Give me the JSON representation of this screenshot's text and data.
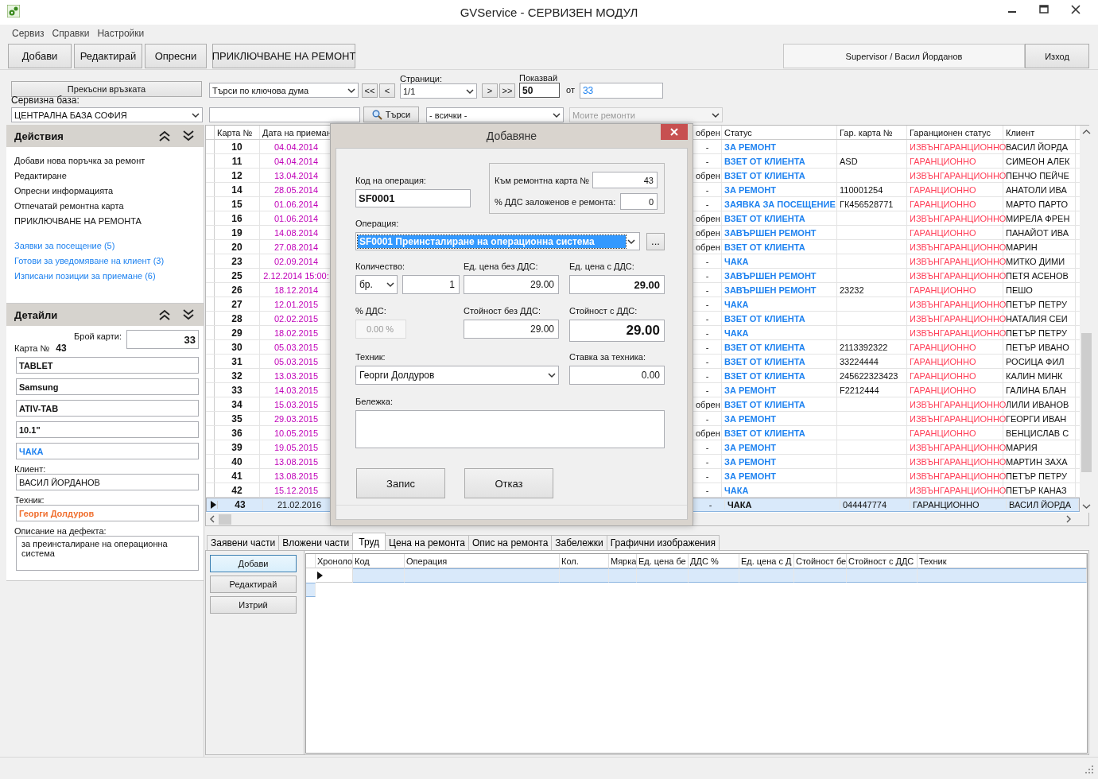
{
  "window": {
    "title": "GVService - СЕРВИЗЕН МОДУЛ"
  },
  "menu": [
    "Сервиз",
    "Справки",
    "Настройки"
  ],
  "toolbar": {
    "buttons": [
      "Добави",
      "Редактирай",
      "Опресни",
      "ПРИКЛЮЧВАНЕ НА РЕМОНТ"
    ],
    "user": "Supervisor / Васил Йорданов",
    "exit": "Изход"
  },
  "connection": {
    "disconnect_button": "Прекъсни връзката",
    "base_label": "Сервизна база:",
    "base_value": "ЦЕНТРАЛНА БАЗА СОФИЯ"
  },
  "search": {
    "mode": "Търси по ключова дума",
    "search_button": "Търси",
    "filter": "- всички -",
    "repairs_filter": "Моите ремонти",
    "repairs_filter_disabled": true
  },
  "paging": {
    "pages_label": "Страници:",
    "page": "1/1",
    "first": "<<",
    "prev": "<",
    "next": ">",
    "last": ">>",
    "show_label": "Показвай",
    "show_value": "50",
    "of_label": "от",
    "total": "33"
  },
  "actions": {
    "title": "Действия",
    "items": [
      "Добави нова поръчка за ремонт",
      "Редактиране",
      "Опресни информацията",
      "Отпечатай ремонтна карта",
      "ПРИКЛЮЧВАНЕ НА РЕМОНТА"
    ],
    "links": [
      "Заявки за посещение (5)",
      "Готови за уведомяване на клиент (3)",
      "Изписани позиции за приемане (6)"
    ]
  },
  "details": {
    "title": "Детайли",
    "count_label": "Брой карти:",
    "count": "33",
    "card_label": "Карта №",
    "card_number": "43",
    "fields": [
      {
        "value": "TABLET",
        "kind": "plain"
      },
      {
        "value": "Samsung",
        "kind": "plain"
      },
      {
        "value": "ATIV-TAB",
        "kind": "plain"
      },
      {
        "value": "10.1\"",
        "kind": "plain"
      },
      {
        "value": "ЧАКА",
        "kind": "status"
      }
    ],
    "client_label": "Клиент:",
    "client": "ВАСИЛ ЙОРДАНОВ",
    "technician_label": "Техник:",
    "technician": "Георги Долдуров",
    "defect_label": "Описание на дефекта:",
    "defect": "за преинсталиране на операционна система"
  },
  "grid": {
    "columns": [
      "Карта №",
      "Дата на приеман",
      "обрен",
      "Статус",
      "Гар. карта №",
      "Гаранционен статус",
      "Клиент"
    ],
    "rows": [
      {
        "card": "10",
        "date": "04.04.2014",
        "column_3": "-",
        "status": "ЗА РЕМОНТ",
        "warranty_status": "ИЗВЪНГАРАНЦИОННО",
        "client": "ВАСИЛ ЙОРДА",
        "selected": false
      },
      {
        "card": "11",
        "date": "04.04.2014",
        "column_3": "-",
        "status": "ВЗЕТ ОТ КЛИЕНТА",
        "warranty_card": "ASD",
        "warranty_status": "ГАРАНЦИОННО",
        "client": "СИМЕОН АЛЕК",
        "selected": false
      },
      {
        "card": "12",
        "date": "13.04.2014",
        "column_3": "обрен",
        "status": "ВЗЕТ ОТ КЛИЕНТА",
        "warranty_status": "ИЗВЪНГАРАНЦИОННО",
        "client": "ПЕНЧО ПЕЙЧЕ",
        "selected": false
      },
      {
        "card": "14",
        "date": "28.05.2014",
        "column_3": "-",
        "status": "ЗА РЕМОНТ",
        "warranty_card": "110001254",
        "warranty_status": "ГАРАНЦИОННО",
        "client": "АНАТОЛИ ИВА",
        "selected": false
      },
      {
        "card": "15",
        "date": "01.06.2014",
        "column_3": "-",
        "status": "ЗАЯВКА ЗА ПОСЕЩЕНИЕ",
        "warranty_card": "ГК456528771",
        "warranty_status": "ГАРАНЦИОННО",
        "client": "МАРТО ПАРТО",
        "selected": false
      },
      {
        "card": "16",
        "date": "01.06.2014",
        "column_3": "обрен",
        "status": "ВЗЕТ ОТ КЛИЕНТА",
        "warranty_status": "ИЗВЪНГАРАНЦИОННО",
        "client": "МИРЕЛА ФРЕН",
        "selected": false
      },
      {
        "card": "19",
        "date": "14.08.2014",
        "column_3": "обрен",
        "status": "ЗАВЪРШЕН РЕМОНТ",
        "warranty_status": "ГАРАНЦИОННО",
        "client": "ПАНАЙОТ ИВА",
        "selected": false
      },
      {
        "card": "20",
        "date": "27.08.2014",
        "column_3": "обрен",
        "status": "ВЗЕТ ОТ КЛИЕНТА",
        "warranty_status": "ИЗВЪНГАРАНЦИОННО",
        "client": "МАРИН",
        "selected": false
      },
      {
        "card": "23",
        "date": "02.09.2014",
        "column_3": "-",
        "status": "ЧАКА",
        "warranty_status": "ИЗВЪНГАРАНЦИОННО",
        "client": "МИТКО ДИМИ",
        "selected": false
      },
      {
        "card": "25",
        "date": "2.12.2014 15:00:",
        "column_3": "-",
        "status": "ЗАВЪРШЕН РЕМОНТ",
        "warranty_status": "ИЗВЪНГАРАНЦИОННО",
        "client": "ПЕТЯ АСЕНОВ",
        "selected": false
      },
      {
        "card": "26",
        "date": "18.12.2014",
        "column_3": "-",
        "status": "ЗАВЪРШЕН РЕМОНТ",
        "warranty_card": "23232",
        "warranty_status": "ГАРАНЦИОННО",
        "client": "ПЕШО",
        "selected": false
      },
      {
        "card": "27",
        "date": "12.01.2015",
        "column_3": "-",
        "status": "ЧАКА",
        "warranty_status": "ИЗВЪНГАРАНЦИОННО",
        "client": "ПЕТЪР ПЕТРУ",
        "selected": false
      },
      {
        "card": "28",
        "date": "02.02.2015",
        "column_3": "-",
        "status": "ВЗЕТ ОТ КЛИЕНТА",
        "warranty_status": "ИЗВЪНГАРАНЦИОННО",
        "client": "НАТАЛИЯ СЕИ",
        "selected": false
      },
      {
        "card": "29",
        "date": "18.02.2015",
        "column_3": "-",
        "status": "ЧАКА",
        "warranty_status": "ИЗВЪНГАРАНЦИОННО",
        "client": "ПЕТЪР ПЕТРУ",
        "selected": false
      },
      {
        "card": "30",
        "date": "05.03.2015",
        "column_3": "-",
        "status": "ВЗЕТ ОТ КЛИЕНТА",
        "warranty_card": "2113392322",
        "warranty_status": "ГАРАНЦИОННО",
        "client": "ПЕТЪР ИВАНО",
        "selected": false
      },
      {
        "card": "31",
        "date": "05.03.2015",
        "column_3": "-",
        "status": "ВЗЕТ ОТ КЛИЕНТА",
        "warranty_card": "33224444",
        "warranty_status": "ГАРАНЦИОННО",
        "client": "РОСИЦА ФИЛ",
        "selected": false
      },
      {
        "card": "32",
        "date": "13.03.2015",
        "column_3": "-",
        "status": "ВЗЕТ ОТ КЛИЕНТА",
        "warranty_card": "245622323423",
        "warranty_status": "ГАРАНЦИОННО",
        "client": "КАЛИН МИНК",
        "selected": false
      },
      {
        "card": "33",
        "date": "14.03.2015",
        "column_3": "-",
        "status": "ЗА РЕМОНТ",
        "warranty_card": "F2212444",
        "warranty_status": "ГАРАНЦИОННО",
        "client": "ГАЛИНА БЛАН",
        "selected": false
      },
      {
        "card": "34",
        "date": "15.03.2015",
        "column_3": "обрен",
        "status": "ВЗЕТ ОТ КЛИЕНТА",
        "warranty_status": "ИЗВЪНГАРАНЦИОННО",
        "client": "ЛИЛИ ИВАНОВ",
        "selected": false
      },
      {
        "card": "35",
        "date": "29.03.2015",
        "column_3": "-",
        "status": "ЗА РЕМОНТ",
        "warranty_status": "ИЗВЪНГАРАНЦИОННО",
        "client": "ГЕОРГИ ИВАН",
        "selected": false
      },
      {
        "card": "36",
        "date": "10.05.2015",
        "column_3": "обрен",
        "status": "ВЗЕТ ОТ КЛИЕНТА",
        "warranty_status": "ГАРАНЦИОННО",
        "client": "ВЕНЦИСЛАВ С",
        "selected": false
      },
      {
        "card": "39",
        "date": "19.05.2015",
        "column_3": "-",
        "status": "ЗА РЕМОНТ",
        "warranty_status": "ИЗВЪНГАРАНЦИОННО",
        "client": "МАРИЯ",
        "selected": false
      },
      {
        "card": "40",
        "date": "13.08.2015",
        "column_3": "-",
        "status": "ЗА РЕМОНТ",
        "warranty_status": "ИЗВЪНГАРАНЦИОННО",
        "client": "МАРТИН ЗАХА",
        "selected": false
      },
      {
        "card": "41",
        "date": "13.08.2015",
        "column_3": "-",
        "status": "ЗА РЕМОНТ",
        "warranty_status": "ИЗВЪНГАРАНЦИОННО",
        "client": "ПЕТЪР ПЕТРУ",
        "selected": false
      },
      {
        "card": "42",
        "date": "15.12.2015",
        "column_3": "-",
        "status": "ЧАКА",
        "warranty_status": "ИЗВЪНГАРАНЦИОННО",
        "client": "ПЕТЪР КАНАЗ",
        "selected": false
      },
      {
        "card": "43",
        "date": "21.02.2016",
        "column_3": "-",
        "status": "ЧАКА",
        "warranty_card": "044447774",
        "warranty_status": "ГАРАНЦИОННО",
        "client": "ВАСИЛ ЙОРДА",
        "selected": true
      }
    ]
  },
  "tabs": [
    {
      "label": "Заявени части",
      "selected": false
    },
    {
      "label": "Вложени части",
      "selected": false
    },
    {
      "label": "Труд",
      "selected": true
    },
    {
      "label": "Цена на ремонта",
      "selected": false
    },
    {
      "label": "Опис на ремонта",
      "selected": false
    },
    {
      "label": "Забележки",
      "selected": false
    },
    {
      "label": "Графични изображения",
      "selected": false
    }
  ],
  "labor": {
    "buttons": [
      "Добави",
      "Редактирай",
      "Изтрий"
    ],
    "columns": [
      "Хроноло",
      "Код",
      "Операция",
      "Кол.",
      "Мярка",
      "Ед. цена бе",
      "ДДС %",
      "Ед. цена с Д",
      "Стойност бе",
      "Стойност с ДДС",
      "Техник"
    ]
  },
  "dialog": {
    "title": "Добавяне",
    "code_label": "Код на операция:",
    "code": "SF0001",
    "card_label": "Към ремонтна карта №",
    "card": "43",
    "vat_label": "% ДДС заложенов е ремонта:",
    "vat": "0",
    "operation_label": "Операция:",
    "operation": "SF0001 Преинсталиране на операционна система",
    "more_button": "...",
    "qty_label": "Количество:",
    "unit": "бр.",
    "qty": "1",
    "unit_price_label": "Ед. цена без ДДС:",
    "unit_price": "29.00",
    "unit_price_vat_label": "Ед. цена с ДДС:",
    "unit_price_vat": "29.00",
    "vat_pct_label": "% ДДС:",
    "vat_pct": "0.00 %",
    "vat_pct_disabled": true,
    "total_label": "Стойност без ДДС:",
    "total": "29.00",
    "total_vat_label": "Стойност с ДДС:",
    "total_vat": "29.00",
    "tech_label": "Техник:",
    "tech": "Георги Долдуров",
    "rate_label": "Ставка за техника:",
    "rate": "0.00",
    "note_label": "Бележка:",
    "buttons": [
      "Запис",
      "Отказ"
    ]
  }
}
